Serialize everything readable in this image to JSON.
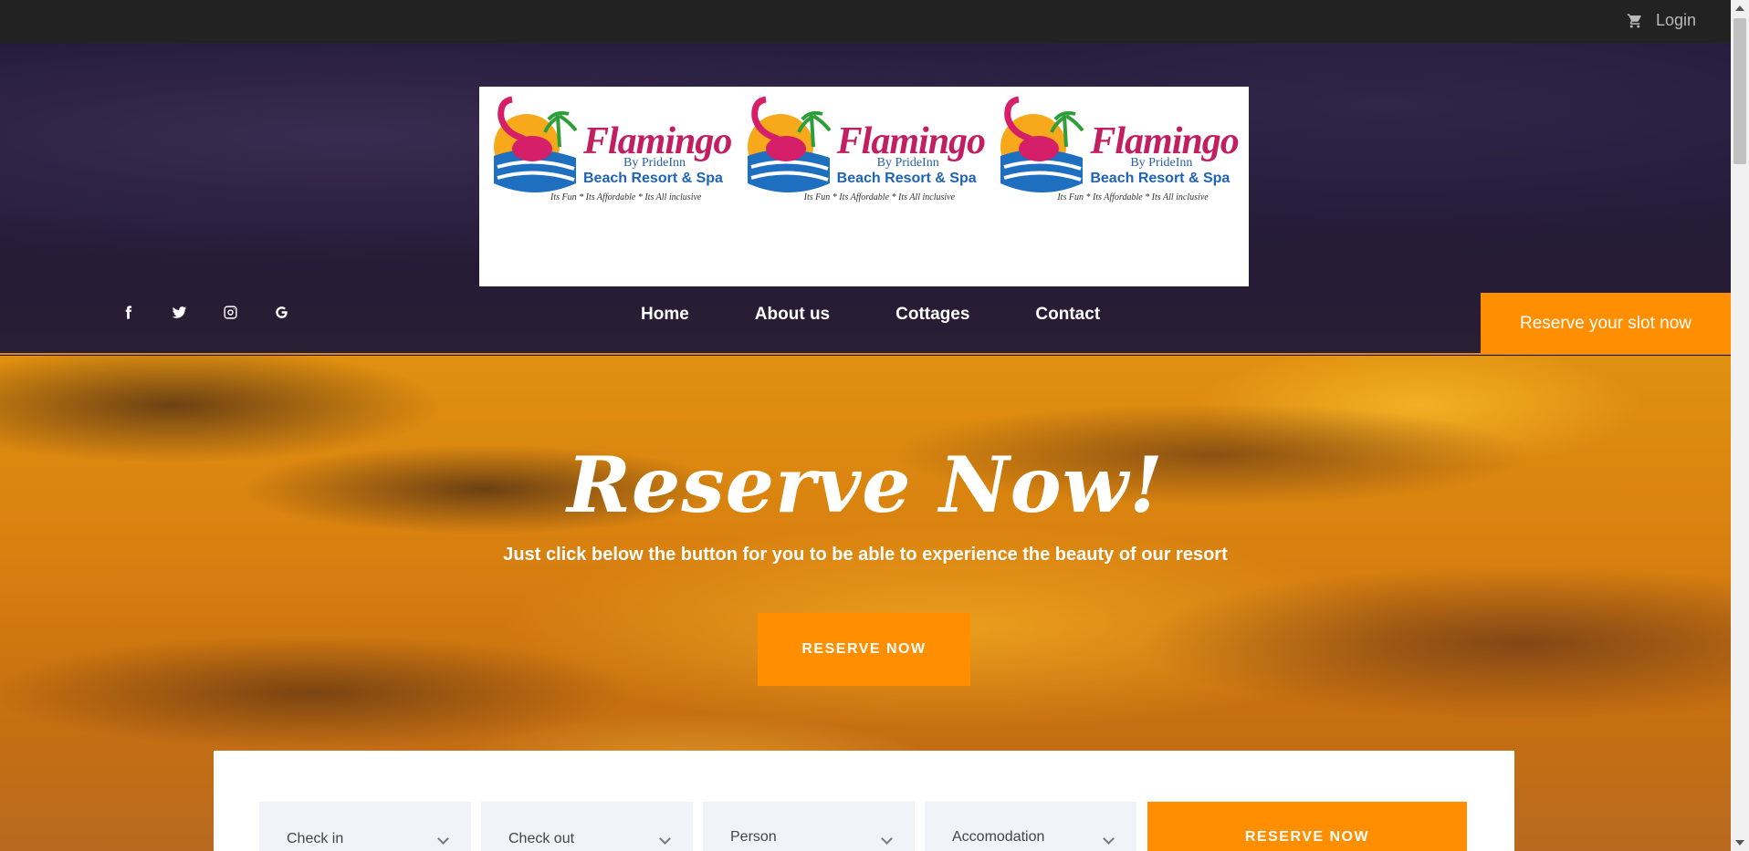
{
  "topbar": {
    "login_label": "Login",
    "cart_icon": "cart-icon"
  },
  "logo": {
    "brand": "Flamingo",
    "by": "By PrideInn",
    "resort": "Beach Resort & Spa",
    "tagline": "Its Fun  * Its Affordable * Its All inclusive",
    "colors": {
      "brand": "#c21e62",
      "resort": "#1e63b6"
    }
  },
  "social": {
    "icons": [
      "facebook-icon",
      "twitter-icon",
      "instagram-icon",
      "google-icon"
    ]
  },
  "nav": {
    "items": [
      "Home",
      "About us",
      "Cottages",
      "Contact"
    ]
  },
  "header_cta": {
    "label": "Reserve your slot now"
  },
  "hero": {
    "title": "Reserve Now!",
    "subtitle": "Just click below the button for you to be able to experience the beauty of our resort",
    "cta_label": "RESERVE NOW"
  },
  "booking": {
    "fields": [
      "Check in",
      "Check out",
      "Person",
      "Accomodation"
    ],
    "submit_label": "RESERVE NOW"
  },
  "colors": {
    "accent": "#ff8f00",
    "topbar": "#222222"
  }
}
